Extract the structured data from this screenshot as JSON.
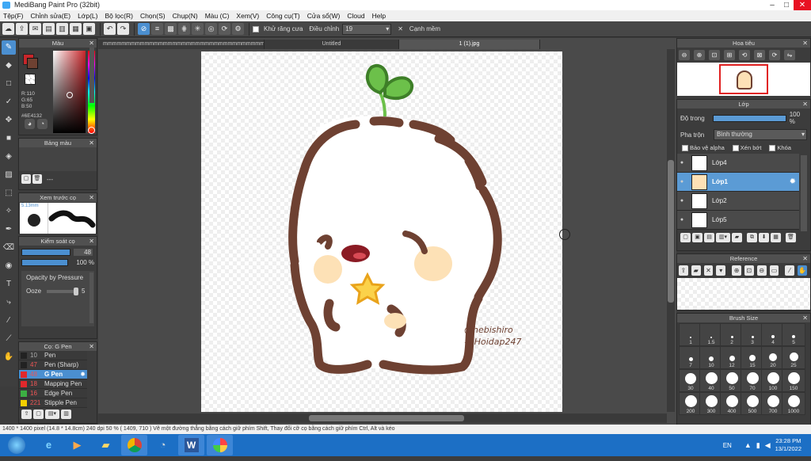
{
  "window": {
    "title": "MediBang Paint Pro (32bit)"
  },
  "menu": [
    "Tệp(F)",
    "Chỉnh sửa(E)",
    "Lớp(L)",
    "Bộ lọc(R)",
    "Chọn(S)",
    "Chụp(N)",
    "Màu (C)",
    "Xem(V)",
    "Công cụ(T)",
    "Cửa sổ(W)",
    "Cloud",
    "Help"
  ],
  "toolbar": {
    "antialias_label": "Khử răng cưa",
    "adjust_label": "Điều chỉnh",
    "adjust_value": "19",
    "smooth_label": "Cạnh mềm"
  },
  "color_panel": {
    "title": "Màu",
    "r": "R:110",
    "g": "G:65",
    "b": "B:50",
    "hex": "#6E4132",
    "main_color": "#6e4132",
    "sub_color": "#c8262a"
  },
  "palette_panel": {
    "title": "Bảng màu",
    "extra": "---"
  },
  "brush_preview": {
    "title": "Xem trước cọ",
    "size": "5.13mm"
  },
  "brush_control": {
    "title": "Kiểm soát cọ",
    "size_value": "48",
    "opacity_value": "100 %",
    "opacity_by_pressure": "Opacity by Pressure",
    "ooze": "Ooze",
    "ooze_value": "5"
  },
  "brush_list": {
    "title": "Cọ: G Pen",
    "items": [
      {
        "size": "10",
        "name": "Pen",
        "color": "#222222"
      },
      {
        "size": "47",
        "name": "Pen (Sharp)",
        "color": "#222222"
      },
      {
        "size": "48",
        "name": "G Pen",
        "color": "#e0282c",
        "active": true
      },
      {
        "size": "18",
        "name": "Mapping Pen",
        "color": "#e0282c"
      },
      {
        "size": "16",
        "name": "Edge Pen",
        "color": "#3cb043"
      },
      {
        "size": "221",
        "name": "Stipple Pen",
        "color": "#f5d000"
      }
    ]
  },
  "tabs": [
    {
      "label": "mmmmmmmmmmmmmmmmmmmmmmmmmmmmmmmmmmm.mdp",
      "active": false
    },
    {
      "label": "Untitled",
      "active": false
    },
    {
      "label": "1 (1).jpg",
      "active": true
    }
  ],
  "artwork": {
    "signature": "@hebishiro",
    "hashtag": "# Hoidap247"
  },
  "navigator": {
    "title": "Hoa tiêu"
  },
  "layer_panel": {
    "title": "Lớp",
    "opacity_label": "Độ trong",
    "opacity_value": "100 %",
    "opacity_fraction": 1.0,
    "blend_label": "Pha trộn",
    "blend_value": "Bình thường",
    "protect_alpha": "Bảo vệ alpha",
    "clip": "Xén bớt",
    "lock": "Khóa",
    "layers": [
      {
        "name": "Lớp4",
        "active": false
      },
      {
        "name": "Lớp1",
        "active": true
      },
      {
        "name": "Lớp2",
        "active": false
      },
      {
        "name": "Lớp5",
        "active": false
      }
    ]
  },
  "reference": {
    "title": "Reference"
  },
  "brush_size": {
    "title": "Brush Size",
    "sizes": [
      "1",
      "1.5",
      "2",
      "3",
      "4",
      "5",
      "7",
      "10",
      "12",
      "15",
      "20",
      "25",
      "30",
      "40",
      "50",
      "70",
      "100",
      "150",
      "200",
      "300",
      "400",
      "500",
      "700",
      "1000"
    ]
  },
  "status": {
    "text": "1400 * 1400 pixel  (14.8 * 14.8cm)  240 dpi  50 %  ( 1409, 710 )  Vẽ một đường thẳng bằng cách giữ phím Shift, Thay đổi cỡ cọ bằng cách giữ phím Ctrl, Alt và kéo"
  },
  "taskbar": {
    "lang": "EN",
    "time": "23:28 PM",
    "date": "13/1/2022"
  }
}
